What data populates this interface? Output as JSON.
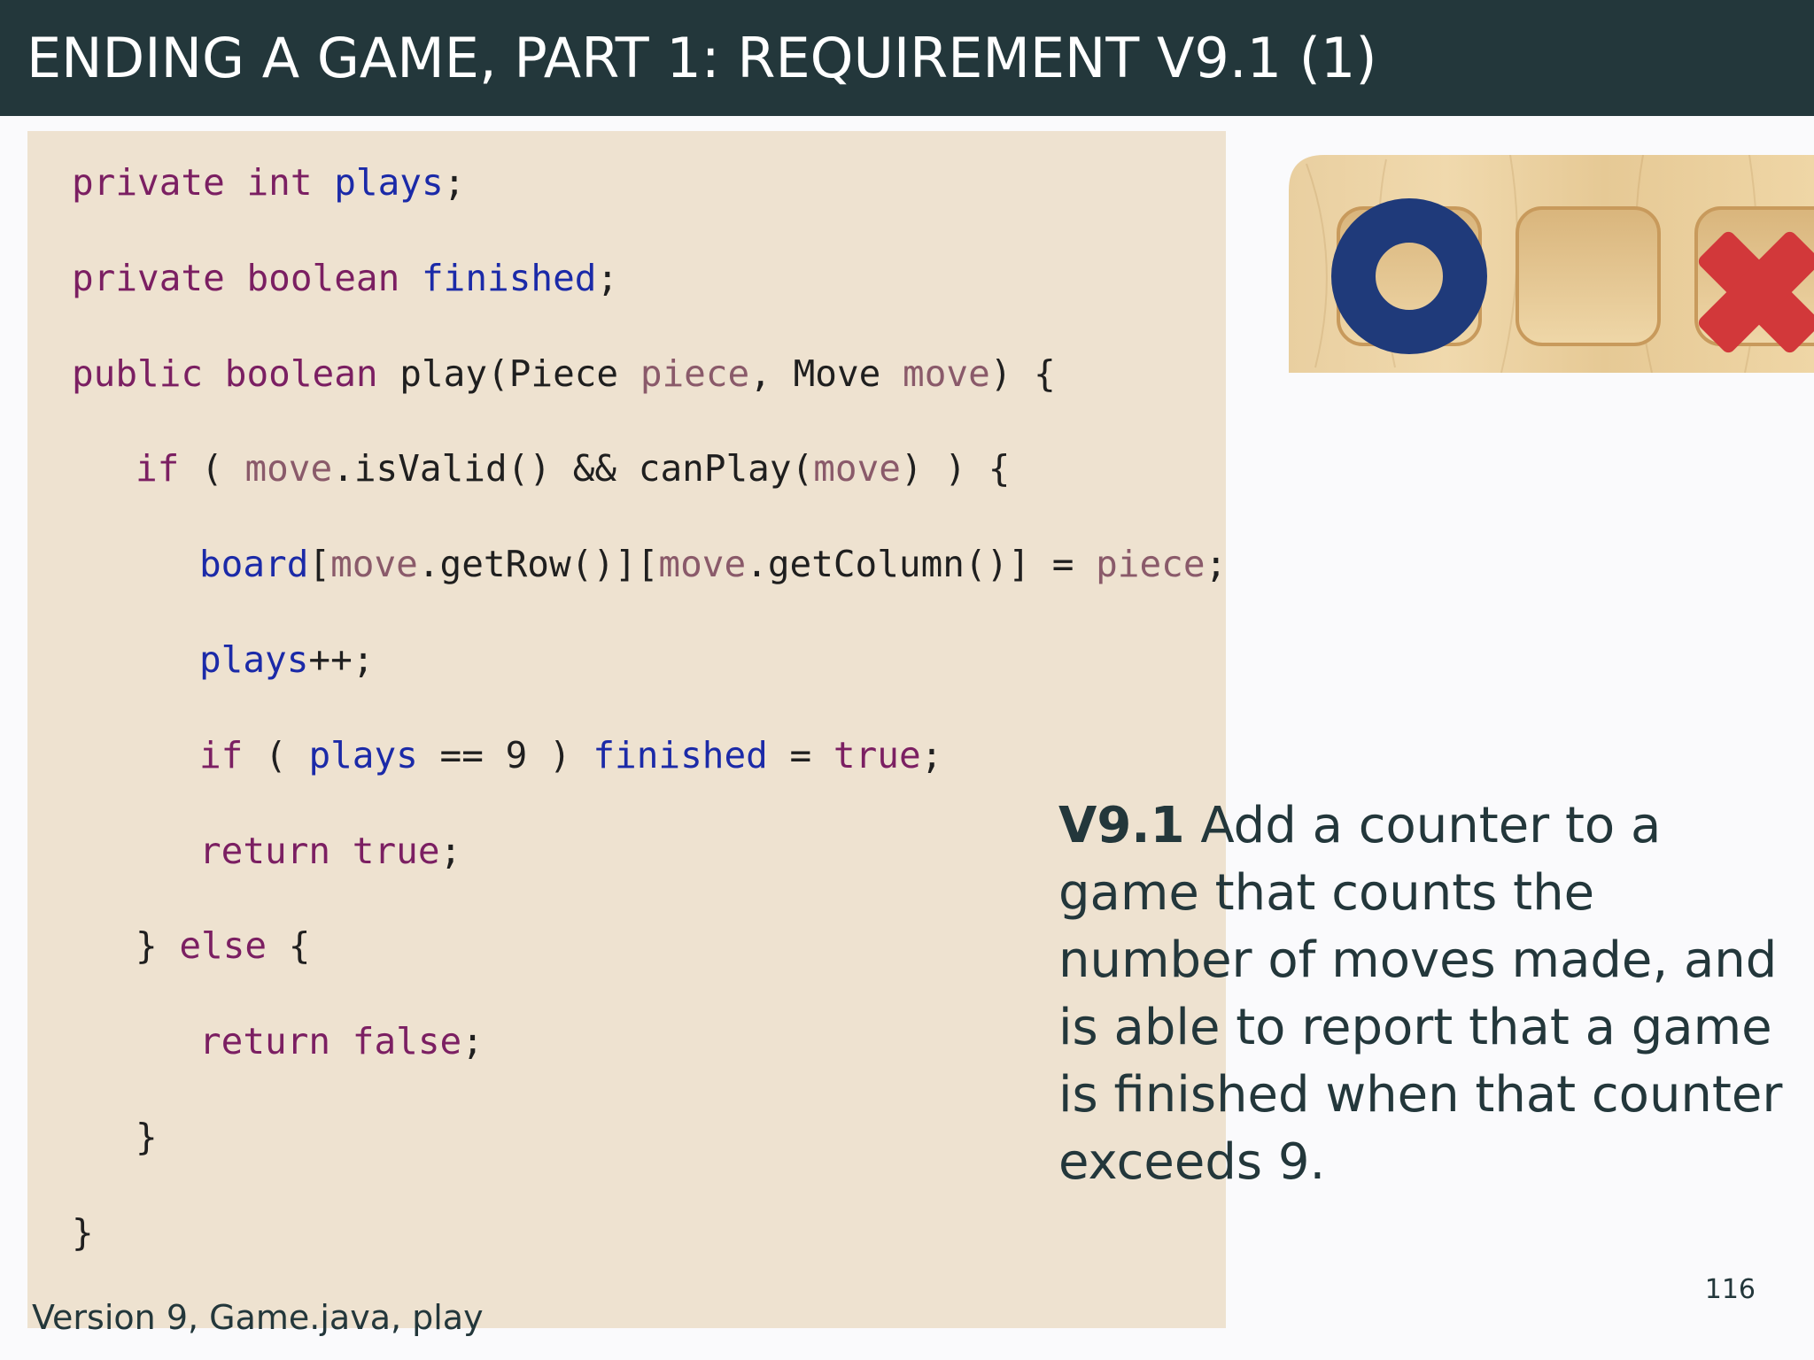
{
  "title": "ENDING A GAME, PART 1: REQUIREMENT V9.1 (1)",
  "code": {
    "lines": [
      {
        "indent": 0,
        "tokens": [
          {
            "t": "private",
            "c": "kw"
          },
          {
            "t": " "
          },
          {
            "t": "int",
            "c": "kw"
          },
          {
            "t": " "
          },
          {
            "t": "plays",
            "c": "fld"
          },
          {
            "t": ";"
          }
        ]
      },
      {
        "indent": 0,
        "tokens": [
          {
            "t": "private",
            "c": "kw"
          },
          {
            "t": " "
          },
          {
            "t": "boolean",
            "c": "kw"
          },
          {
            "t": " "
          },
          {
            "t": "finished",
            "c": "fld"
          },
          {
            "t": ";"
          }
        ]
      },
      {
        "indent": 0,
        "tokens": [
          {
            "t": "public",
            "c": "kw"
          },
          {
            "t": " "
          },
          {
            "t": "boolean",
            "c": "kw"
          },
          {
            "t": " play(Piece "
          },
          {
            "t": "piece",
            "c": "par"
          },
          {
            "t": ", Move "
          },
          {
            "t": "move",
            "c": "par"
          },
          {
            "t": ") {"
          }
        ]
      },
      {
        "indent": 1,
        "tokens": [
          {
            "t": "if",
            "c": "kw"
          },
          {
            "t": " ( "
          },
          {
            "t": "move",
            "c": "par"
          },
          {
            "t": ".isValid() && canPlay("
          },
          {
            "t": "move",
            "c": "par"
          },
          {
            "t": ") ) {"
          }
        ]
      },
      {
        "indent": 2,
        "tokens": [
          {
            "t": "board",
            "c": "fld"
          },
          {
            "t": "["
          },
          {
            "t": "move",
            "c": "par"
          },
          {
            "t": ".getRow()]["
          },
          {
            "t": "move",
            "c": "par"
          },
          {
            "t": ".getColumn()] = "
          },
          {
            "t": "piece",
            "c": "par"
          },
          {
            "t": ";"
          }
        ]
      },
      {
        "indent": 2,
        "tokens": [
          {
            "t": "plays",
            "c": "fld"
          },
          {
            "t": "++;"
          }
        ]
      },
      {
        "indent": 2,
        "tokens": [
          {
            "t": "if",
            "c": "kw"
          },
          {
            "t": " ( "
          },
          {
            "t": "plays",
            "c": "fld"
          },
          {
            "t": " == 9 ) "
          },
          {
            "t": "finished",
            "c": "fld"
          },
          {
            "t": " = "
          },
          {
            "t": "true",
            "c": "kw"
          },
          {
            "t": ";"
          }
        ]
      },
      {
        "indent": 2,
        "tokens": [
          {
            "t": "return",
            "c": "kw"
          },
          {
            "t": " "
          },
          {
            "t": "true",
            "c": "kw"
          },
          {
            "t": ";"
          }
        ]
      },
      {
        "indent": 1,
        "tokens": [
          {
            "t": "} "
          },
          {
            "t": "else",
            "c": "kw"
          },
          {
            "t": " {"
          }
        ]
      },
      {
        "indent": 2,
        "tokens": [
          {
            "t": "return",
            "c": "kw"
          },
          {
            "t": " "
          },
          {
            "t": "false",
            "c": "kw"
          },
          {
            "t": ";"
          }
        ]
      },
      {
        "indent": 1,
        "tokens": [
          {
            "t": "}"
          }
        ]
      },
      {
        "indent": 0,
        "tokens": [
          {
            "t": "}"
          }
        ]
      }
    ]
  },
  "caption": "Version 9, Game.java, play",
  "requirement": {
    "id": "V9.1",
    "text": "Add a counter to a game that counts the number of moves made, and is able to report that a game is finished when that counter exceeds 9."
  },
  "page_number": "116",
  "image": {
    "description_icon": "tic-tac-toe-board-image",
    "pieces": [
      "O",
      "empty",
      "X"
    ]
  },
  "colors": {
    "header_bg": "#23373b",
    "code_bg": "#eee2d0",
    "keyword": "#7b1f62",
    "field": "#1b2aa8",
    "parameter": "#8a5a6a"
  }
}
